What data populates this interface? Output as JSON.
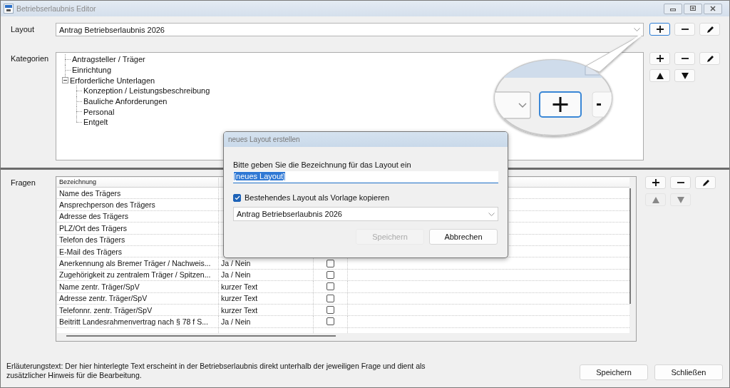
{
  "window": {
    "title": "Betriebserlaubnis Editor"
  },
  "layout": {
    "label": "Layout",
    "value": "Antrag Betriebserlaubnis 2026",
    "buttons": [
      {
        "kind": "add",
        "focused": true,
        "disabled": false
      },
      {
        "kind": "remove",
        "focused": false,
        "disabled": false
      },
      {
        "kind": "edit",
        "focused": false,
        "disabled": false
      }
    ]
  },
  "categories": {
    "label": "Kategorien",
    "tree": [
      {
        "label": "Antragsteller / Träger"
      },
      {
        "label": "Einrichtung"
      },
      {
        "label": "Erforderliche Unterlagen",
        "expanded": true,
        "children": [
          {
            "label": "Konzeption / Leistungsbeschreibung"
          },
          {
            "label": "Bauliche Anforderungen"
          },
          {
            "label": "Personal"
          },
          {
            "label": "Entgelt"
          }
        ]
      }
    ],
    "buttons": [
      {
        "kind": "add",
        "focused": false,
        "disabled": false
      },
      {
        "kind": "remove",
        "focused": false,
        "disabled": false
      },
      {
        "kind": "edit",
        "focused": false,
        "disabled": false
      },
      {
        "kind": "up",
        "focused": false,
        "disabled": false
      },
      {
        "kind": "down",
        "focused": false,
        "disabled": false
      }
    ]
  },
  "questions": {
    "label": "Fragen",
    "columns": [
      "Bezeichnung"
    ],
    "rows": [
      {
        "name": "Name des Trägers"
      },
      {
        "name": "Ansprechperson des Trägers"
      },
      {
        "name": "Adresse des Trägers"
      },
      {
        "name": "PLZ/Ort des Trägers"
      },
      {
        "name": "Telefon des Trägers"
      },
      {
        "name": "E-Mail des Trägers"
      },
      {
        "name": "Anerkennung als Bremer Träger / Nachweis...",
        "type": "Ja / Nein",
        "checked": false
      },
      {
        "name": "Zugehörigkeit zu zentralem Träger / Spitzen...",
        "type": "Ja / Nein",
        "checked": false
      },
      {
        "name": "Name zentr. Träger/SpV",
        "type": "kurzer Text",
        "checked": false
      },
      {
        "name": "Adresse zentr. Träger/SpV",
        "type": "kurzer Text",
        "checked": false
      },
      {
        "name": "Telefonnr. zentr. Träger/SpV",
        "type": "kurzer Text",
        "checked": false
      },
      {
        "name": "Beitritt Landesrahmenvertrag nach § 78 f S...",
        "type": "Ja / Nein",
        "checked": false
      }
    ],
    "buttons": [
      {
        "kind": "add",
        "focused": false,
        "disabled": false
      },
      {
        "kind": "remove",
        "focused": false,
        "disabled": false
      },
      {
        "kind": "edit",
        "focused": false,
        "disabled": false
      },
      {
        "kind": "up",
        "focused": false,
        "disabled": true
      },
      {
        "kind": "down",
        "focused": false,
        "disabled": true
      }
    ]
  },
  "footer": {
    "hint": "Erläuterungstext: Der hier hinterlegte Text erscheint in der Betriebserlaubnis direkt unterhalb der jeweiligen Frage und dient als zusätzlicher Hinweis für die Bearbeitung.",
    "buttons": [
      {
        "label": "Speichern"
      },
      {
        "label": "Schließen"
      }
    ]
  },
  "dialog": {
    "title": "neues Layout erstellen",
    "prompt": "Bitte geben Sie die Bezeichnung für das Layout ein",
    "value": "[neues Layout]",
    "text_selected": true,
    "copy_template": {
      "label": "Bestehendes Layout als Vorlage kopieren",
      "checked": true
    },
    "template": "Antrag Betriebserlaubnis 2026",
    "buttons": [
      {
        "label": "Speichern",
        "disabled": true
      },
      {
        "label": "Abbrechen",
        "disabled": false
      }
    ]
  }
}
